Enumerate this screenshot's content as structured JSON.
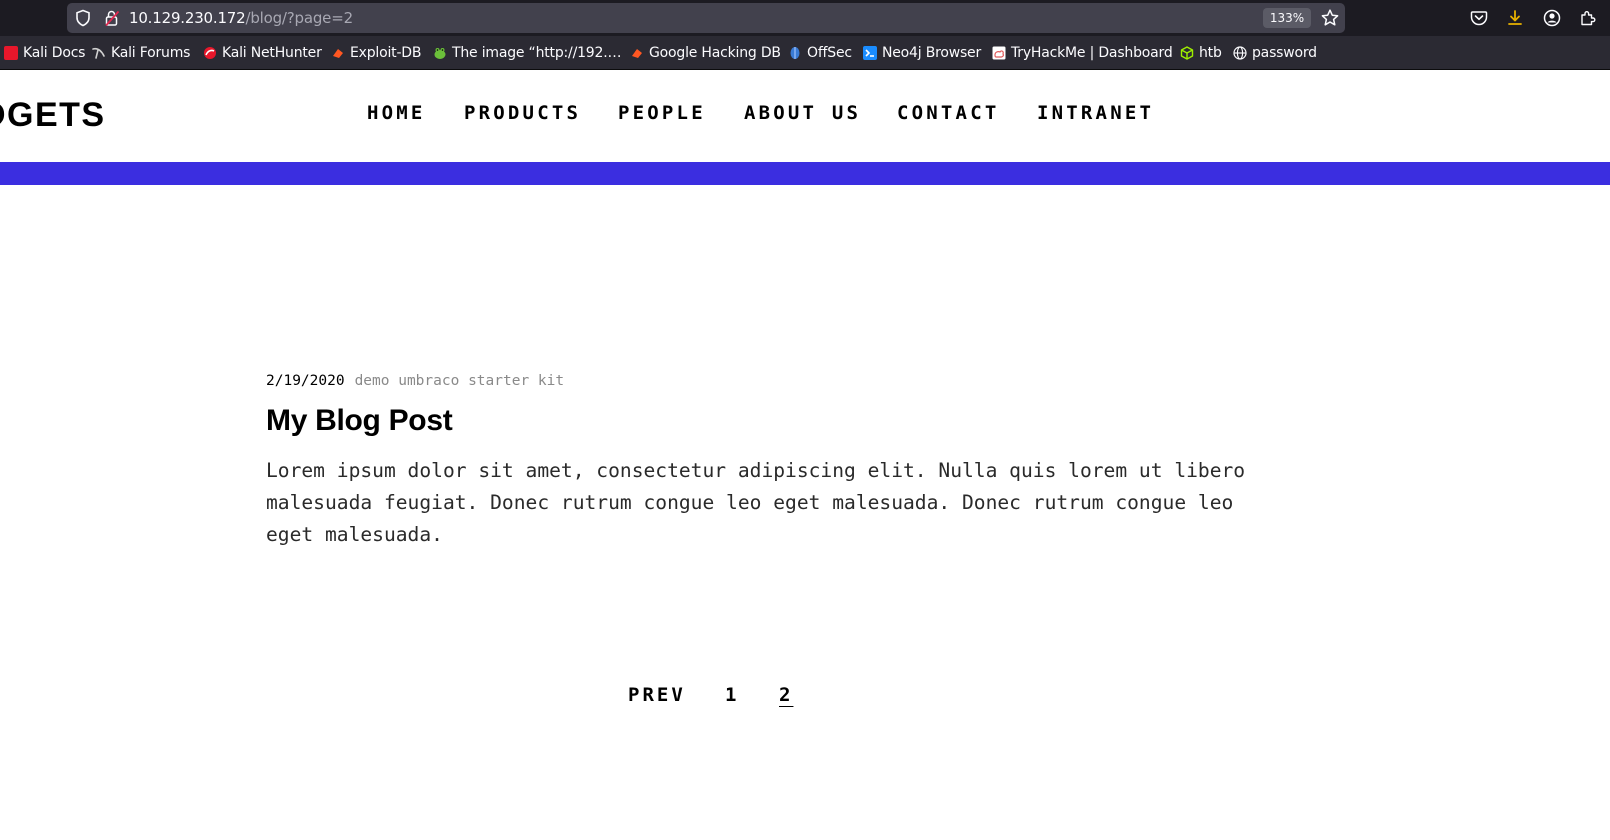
{
  "browser": {
    "url_host": "10.129.230.172",
    "url_path": "/blog/?page=2",
    "zoom_level": "133%",
    "bookmarks": [
      {
        "label": "Kali Docs",
        "icon": "kali-docs-icon",
        "color": "#e8172b"
      },
      {
        "label": "Kali Forums",
        "icon": "kali-dragon-icon",
        "color": "#d0d0d0"
      },
      {
        "label": "Kali NetHunter",
        "icon": "nethunter-icon",
        "color": "#e8172b"
      },
      {
        "label": "Exploit-DB",
        "icon": "exploit-db-icon",
        "color": "#ff5722"
      },
      {
        "label": "The image “http://192.…",
        "icon": "frog-icon",
        "color": "#6bbf3a"
      },
      {
        "label": "Google Hacking DB",
        "icon": "ghdb-icon",
        "color": "#ff5722"
      },
      {
        "label": "OffSec",
        "icon": "offsec-icon",
        "color": "#3a7bd5"
      },
      {
        "label": "Neo4j Browser",
        "icon": "neo4j-icon",
        "color": "#1a8cff"
      },
      {
        "label": "TryHackMe | Dashboard",
        "icon": "tryhackme-icon",
        "color": "#e05a5a"
      },
      {
        "label": "htb",
        "icon": "htb-cube-icon",
        "color": "#9fef00"
      },
      {
        "label": "password",
        "icon": "globe-icon",
        "color": "#fbfbfe"
      }
    ]
  },
  "site": {
    "logo": "IDGETS",
    "nav": [
      {
        "label": "HOME"
      },
      {
        "label": "PRODUCTS"
      },
      {
        "label": "PEOPLE"
      },
      {
        "label": "ABOUT US"
      },
      {
        "label": "CONTACT"
      },
      {
        "label": "INTRANET"
      }
    ],
    "accent_color": "#3b2ee0"
  },
  "post": {
    "date": "2/19/2020",
    "tags": "demo umbraco starter kit",
    "title": "My Blog Post",
    "excerpt": "Lorem ipsum dolor sit amet, consectetur adipiscing elit. Nulla quis lorem ut libero malesuada feugiat. Donec rutrum congue leo eget malesuada. Donec rutrum congue leo eget malesuada."
  },
  "pagination": {
    "prev_label": "PREV",
    "pages": [
      {
        "label": "1",
        "active": false
      },
      {
        "label": "2",
        "active": true
      }
    ]
  }
}
